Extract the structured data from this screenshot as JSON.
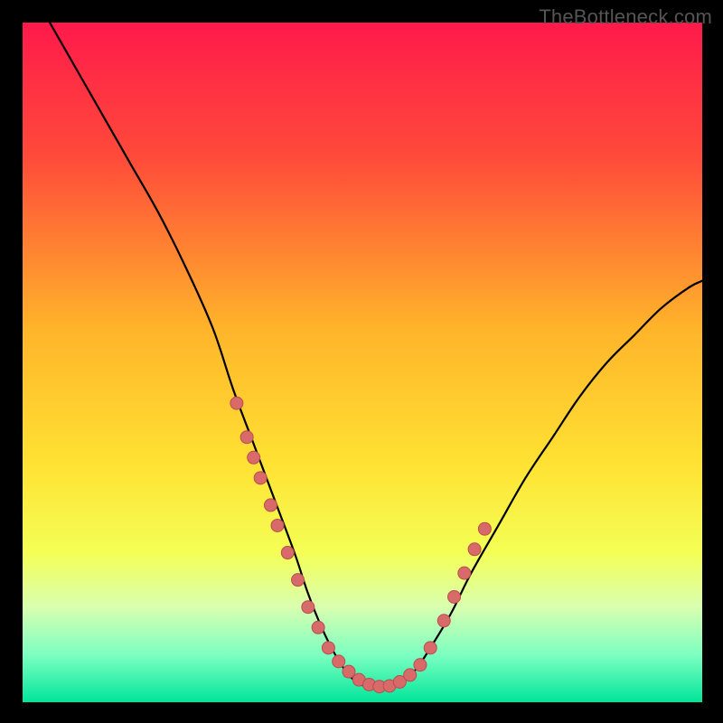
{
  "watermark": "TheBottleneck.com",
  "chart_data": {
    "type": "line",
    "title": "",
    "xlabel": "",
    "ylabel": "",
    "xlim": [
      0,
      100
    ],
    "ylim": [
      0,
      100
    ],
    "gradient_stops": [
      {
        "offset": 0,
        "color": "#ff1a4b"
      },
      {
        "offset": 20,
        "color": "#ff4b3a"
      },
      {
        "offset": 45,
        "color": "#ffb42a"
      },
      {
        "offset": 65,
        "color": "#ffe233"
      },
      {
        "offset": 78,
        "color": "#f4ff55"
      },
      {
        "offset": 86,
        "color": "#d9ffb0"
      },
      {
        "offset": 93,
        "color": "#7dffc1"
      },
      {
        "offset": 100,
        "color": "#00e59a"
      }
    ],
    "series": [
      {
        "name": "bottleneck-curve",
        "x": [
          4,
          8,
          12,
          16,
          20,
          24,
          28,
          31,
          34,
          37,
          40,
          42,
          44,
          46,
          48,
          50,
          52,
          54,
          56,
          58,
          60,
          63,
          66,
          70,
          74,
          78,
          82,
          86,
          90,
          94,
          98,
          100
        ],
        "y": [
          100,
          93,
          86,
          79,
          72,
          64,
          55,
          46,
          38,
          30,
          22,
          16,
          11,
          7,
          4,
          2.5,
          2,
          2.2,
          3,
          5,
          8,
          13,
          19,
          26,
          33,
          39,
          45,
          50,
          54,
          58,
          61,
          62
        ]
      }
    ],
    "markers": [
      {
        "x": 31.5,
        "y": 44
      },
      {
        "x": 33.0,
        "y": 39
      },
      {
        "x": 34.0,
        "y": 36
      },
      {
        "x": 35.0,
        "y": 33
      },
      {
        "x": 36.5,
        "y": 29
      },
      {
        "x": 37.5,
        "y": 26
      },
      {
        "x": 39.0,
        "y": 22
      },
      {
        "x": 40.5,
        "y": 18
      },
      {
        "x": 42.0,
        "y": 14
      },
      {
        "x": 43.5,
        "y": 11
      },
      {
        "x": 45.0,
        "y": 8
      },
      {
        "x": 46.5,
        "y": 6
      },
      {
        "x": 48.0,
        "y": 4.5
      },
      {
        "x": 49.5,
        "y": 3.3
      },
      {
        "x": 51.0,
        "y": 2.6
      },
      {
        "x": 52.5,
        "y": 2.3
      },
      {
        "x": 54.0,
        "y": 2.4
      },
      {
        "x": 55.5,
        "y": 3.0
      },
      {
        "x": 57.0,
        "y": 4.0
      },
      {
        "x": 58.5,
        "y": 5.5
      },
      {
        "x": 60.0,
        "y": 8.0
      },
      {
        "x": 62.0,
        "y": 12.0
      },
      {
        "x": 63.5,
        "y": 15.5
      },
      {
        "x": 65.0,
        "y": 19.0
      },
      {
        "x": 66.5,
        "y": 22.5
      },
      {
        "x": 68.0,
        "y": 25.5
      }
    ],
    "marker_style": {
      "radius_px": 7,
      "fill": "#d96a6a",
      "stroke": "#b74e4e"
    }
  }
}
